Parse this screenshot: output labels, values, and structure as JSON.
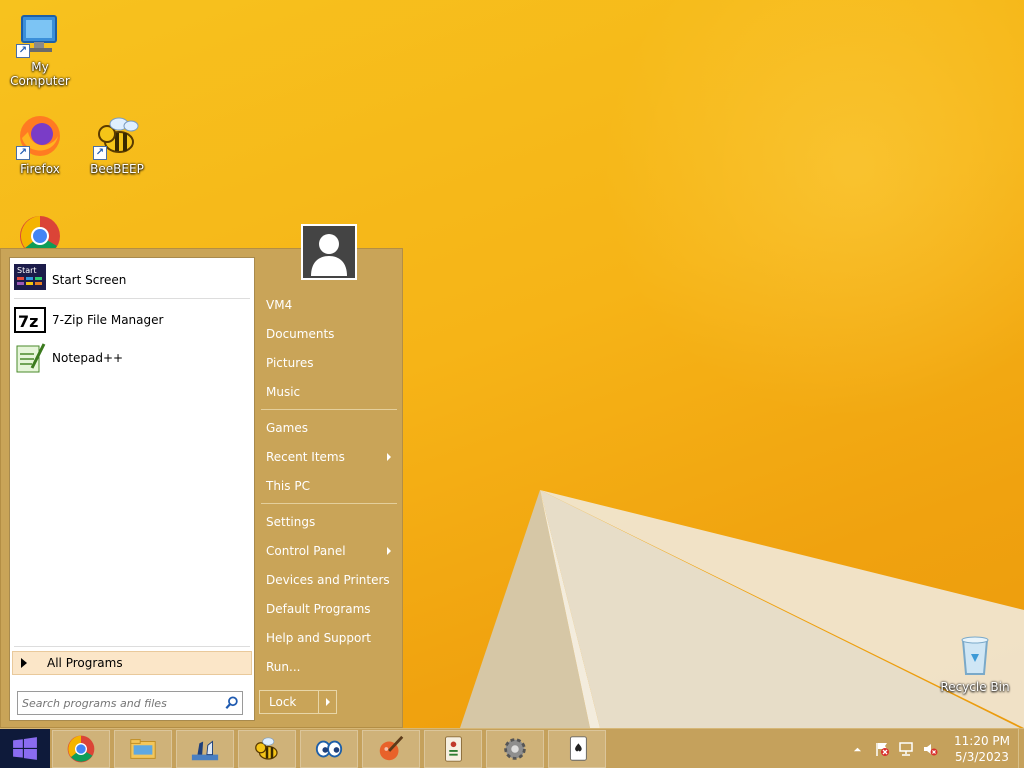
{
  "desktop": {
    "icons": [
      {
        "label": "My Computer"
      },
      {
        "label": "Firefox"
      },
      {
        "label": "BeeBEEP"
      },
      {
        "label": "Recycle Bin"
      }
    ]
  },
  "start_menu": {
    "programs": [
      {
        "label": "Start Screen",
        "icon_text": "Start"
      },
      {
        "label": "7-Zip File Manager",
        "icon_text": "7z"
      },
      {
        "label": "Notepad++"
      }
    ],
    "all_programs": "All Programs",
    "search_placeholder": "Search programs and files",
    "right_items": [
      {
        "label": "VM4"
      },
      {
        "label": "Documents"
      },
      {
        "label": "Pictures"
      },
      {
        "label": "Music"
      },
      {
        "label": "Games"
      },
      {
        "label": "Recent Items"
      },
      {
        "label": "This PC"
      },
      {
        "label": "Settings"
      },
      {
        "label": "Control Panel"
      },
      {
        "label": "Devices and Printers"
      },
      {
        "label": "Default Programs"
      },
      {
        "label": "Help and Support"
      },
      {
        "label": "Run..."
      }
    ],
    "lock_label": "Lock"
  },
  "taskbar": {
    "time": "11:20 PM",
    "date": "5/3/2023"
  },
  "colors": {
    "wallpaper": "#f6b417",
    "menu_bg": "#c9a458",
    "taskbar_bg": "#c5a15c",
    "start_btn": "#0e1a3a"
  }
}
